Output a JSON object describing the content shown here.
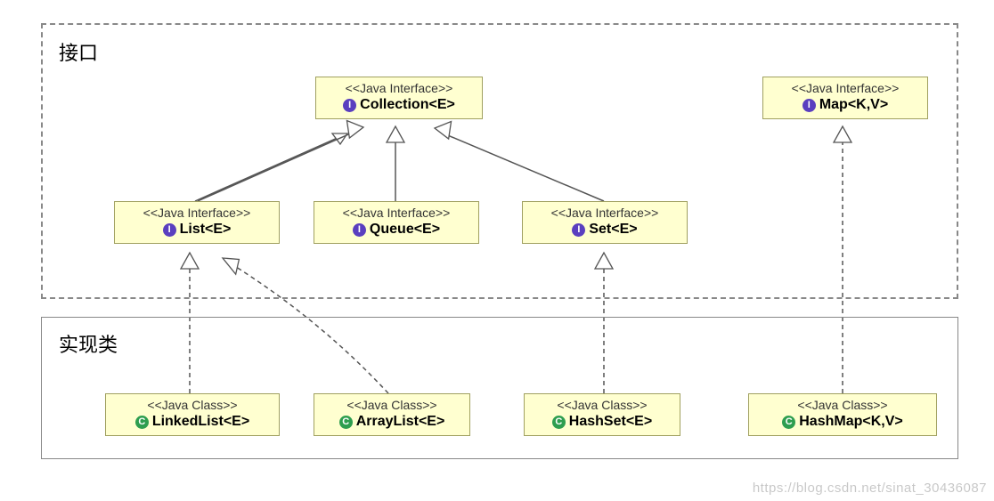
{
  "groups": {
    "interfaces": {
      "label": "接口"
    },
    "classes": {
      "label": "实现类"
    }
  },
  "stereotypes": {
    "interface": "<<Java Interface>>",
    "class": "<<Java Class>>"
  },
  "badges": {
    "interface": "I",
    "class": "C"
  },
  "nodes": {
    "collection": {
      "name": "Collection<E>",
      "kind": "interface"
    },
    "list": {
      "name": "List<E>",
      "kind": "interface"
    },
    "queue": {
      "name": "Queue<E>",
      "kind": "interface"
    },
    "set": {
      "name": "Set<E>",
      "kind": "interface"
    },
    "map": {
      "name": "Map<K,V>",
      "kind": "interface"
    },
    "linkedlist": {
      "name": "LinkedList<E>",
      "kind": "class"
    },
    "arraylist": {
      "name": "ArrayList<E>",
      "kind": "class"
    },
    "hashset": {
      "name": "HashSet<E>",
      "kind": "class"
    },
    "hashmap": {
      "name": "HashMap<K,V>",
      "kind": "class"
    }
  },
  "relations": [
    {
      "from": "list",
      "to": "collection",
      "style": "solid"
    },
    {
      "from": "queue",
      "to": "collection",
      "style": "solid"
    },
    {
      "from": "set",
      "to": "collection",
      "style": "solid"
    },
    {
      "from": "linkedlist",
      "to": "list",
      "style": "dashed"
    },
    {
      "from": "arraylist",
      "to": "list",
      "style": "dashed"
    },
    {
      "from": "hashset",
      "to": "set",
      "style": "dashed"
    },
    {
      "from": "hashmap",
      "to": "map",
      "style": "dashed"
    }
  ],
  "watermark": "https://blog.csdn.net/sinat_30436087"
}
